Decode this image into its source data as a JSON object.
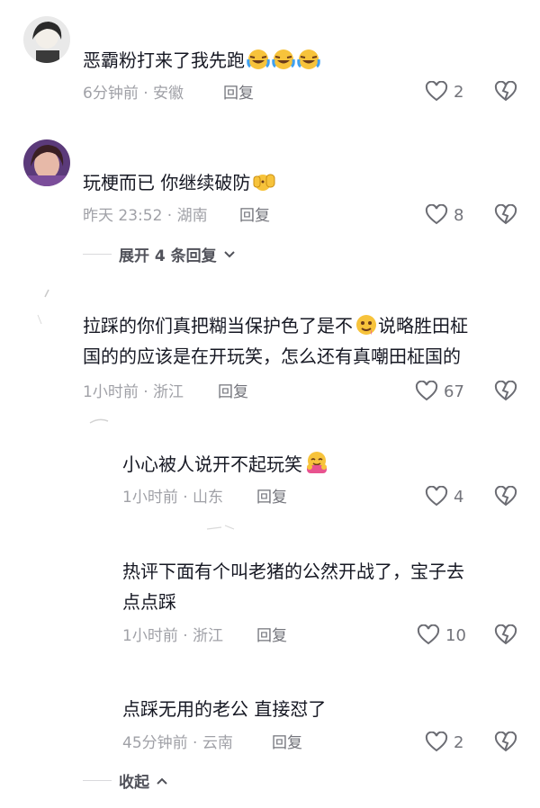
{
  "comments": [
    {
      "text": "恶霸粉打来了我先跑",
      "emoji_count": 3,
      "emoji_kind": "crying-laughing-icon",
      "time": "6分钟前 · 安徽",
      "reply_label": "回复",
      "likes": "2"
    },
    {
      "text": "玩梗而已 你继续破防",
      "emoji_kind": "clapping-icon",
      "time": "昨天 23:52 · 湖南",
      "reply_label": "回复",
      "likes": "8",
      "expand_label": "展开 4 条回复"
    },
    {
      "text_line1": "拉踩的你们真把糊当保护色了是不",
      "text_line2_after_emoji": "说略胜田柾",
      "text_line3": "国的的应该是在开玩笑，怎么还有真嘲田柾国的",
      "emoji_kind": "drool-icon",
      "time": "1小时前 · 浙江",
      "reply_label": "回复",
      "likes": "67"
    }
  ],
  "replies": [
    {
      "text": "小心被人说开不起玩笑",
      "emoji_kind": "hug-icon",
      "time": "1小时前 · 山东",
      "reply_label": "回复",
      "likes": "4"
    },
    {
      "text_line1": "热评下面有个叫老猪的公然开战了，宝子去",
      "text_line2": "点点踩",
      "time": "1小时前 · 浙江",
      "reply_label": "回复",
      "likes": "10"
    },
    {
      "text": "点踩无用的老公 直接怼了",
      "time": "45分钟前 · 云南",
      "reply_label": "回复",
      "likes": "2"
    }
  ],
  "collapse_label": "收起",
  "colors": {
    "text": "#161823",
    "meta": "#a0a1a7",
    "accent_emoji": "#f7c33b"
  }
}
